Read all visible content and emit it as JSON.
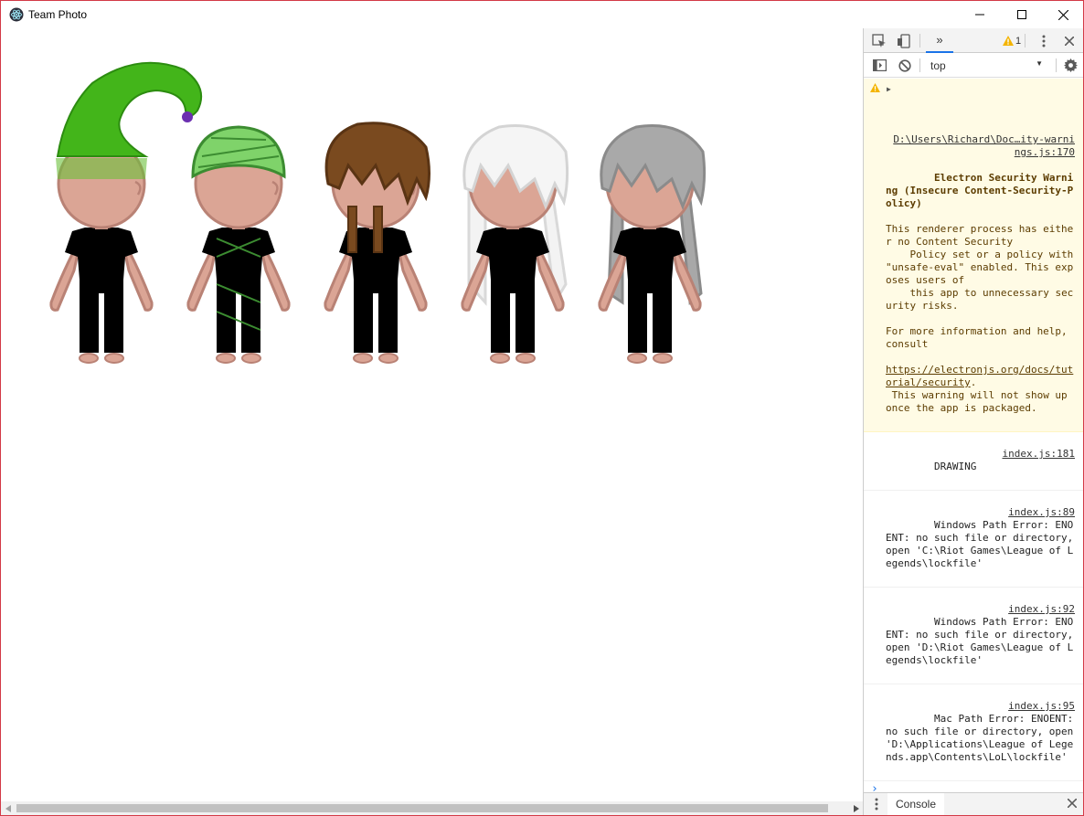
{
  "window": {
    "title": "Team Photo",
    "minimize_icon": "minimize-icon",
    "maximize_icon": "maximize-icon",
    "close_icon": "close-icon"
  },
  "figures": [
    {
      "hat": "green-elf-hat",
      "shirt": "#3b6f8c",
      "pants": "#9a7f88"
    },
    {
      "hat": "green-bandage",
      "shirt": "#3f6a98",
      "pants": "#6fcf5c"
    },
    {
      "hat": "brown-hair-braids",
      "shirt": "#3f6b2e",
      "pants": "#8f9a80"
    },
    {
      "hat": "white-long-hair",
      "shirt": "#2f7560",
      "pants": "#9c8ea8"
    },
    {
      "hat": "grey-long-hair",
      "shirt": "#3f6b2e",
      "pants": "#9590a6"
    }
  ],
  "devtools": {
    "warning_count": "1",
    "context": "top",
    "messages": [
      {
        "type": "warning",
        "source": "D:\\Users\\Richard\\Doc…ity-warnings.js:170",
        "title": "Electron Security Warning (Insecure Content-Security-Policy)",
        "body": "This renderer process has either no Content Security\n    Policy set or a policy with \"unsafe-eval\" enabled. This exposes users of\n    this app to unnecessary security risks.\n\nFor more information and help, consult",
        "link": "https://electronjs.org/docs/tutorial/security",
        "tail": ".\n This warning will not show up\nonce the app is packaged."
      },
      {
        "type": "log",
        "text": "DRAWING",
        "source": "index.js:181"
      },
      {
        "type": "log",
        "text": "Windows Path Error: ENOENT: no such file or directory, open 'C:\\Riot Games\\League of Legends\\lockfile'",
        "source": "index.js:89"
      },
      {
        "type": "log",
        "text": "Windows Path Error: ENOENT: no such file or directory, open 'D:\\Riot Games\\League of Legends\\lockfile'",
        "source": "index.js:92"
      },
      {
        "type": "log",
        "text": "Mac Path Error: ENOENT: no such file or directory, open 'D:\\Applications\\League of Legends.app\\Contents\\LoL\\lockfile'",
        "source": "index.js:95"
      }
    ],
    "drawer_tab": "Console"
  }
}
